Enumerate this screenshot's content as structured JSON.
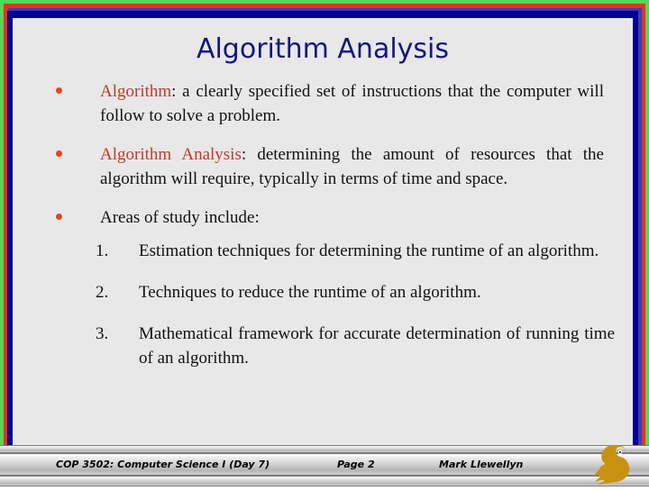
{
  "slide": {
    "title": "Algorithm Analysis",
    "background_color": "#e8e8e8",
    "title_color": "#151580",
    "accent_color": "#c0392b",
    "bullets": [
      {
        "marker": "bullet-dot",
        "accent_text": "Algorithm",
        "rest_text": ": a clearly specified set of instructions that the computer will follow to solve a problem."
      },
      {
        "marker": "bullet-dot",
        "accent_text": "Algorithm Analysis",
        "rest_text": ": determining the amount of resources that the algorithm will require, typically in terms of time and space."
      },
      {
        "marker": "bullet-dot",
        "accent_text": "",
        "rest_text": "Areas of study include:"
      }
    ],
    "numbered_items": [
      {
        "number": "1.",
        "text": "Estimation techniques for determining the runtime of an algorithm."
      },
      {
        "number": "2.",
        "text": "Techniques to reduce the runtime of an algorithm."
      },
      {
        "number": "3.",
        "text": "Mathematical framework for accurate determination of running time of an algorithm."
      }
    ]
  },
  "frame": {
    "outer_color": "#56d65b",
    "middle_color": "#e8301f",
    "inner_color": "#00008f"
  },
  "footer": {
    "course": "COP 3502: Computer Science I  (Day 7)",
    "page": "Page 2",
    "author": "Mark Llewellyn",
    "logo_name": "ucf-knight-logo",
    "logo_color": "#c89211"
  }
}
